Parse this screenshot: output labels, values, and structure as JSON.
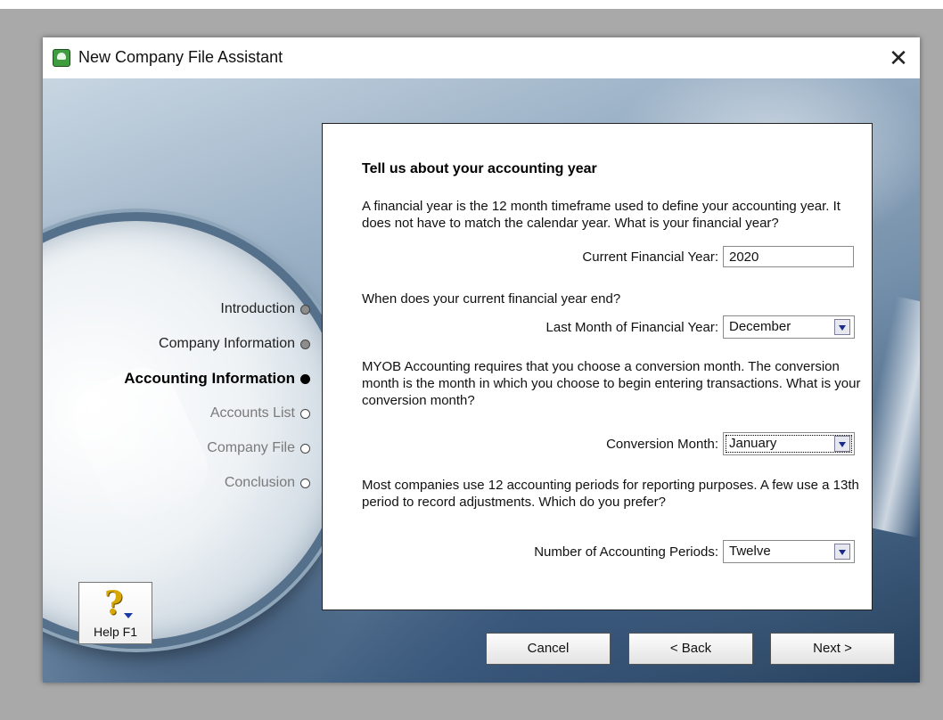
{
  "window": {
    "title": "New Company File Assistant",
    "close_symbol": "✕"
  },
  "steps": [
    {
      "label": "Introduction",
      "state": "done"
    },
    {
      "label": "Company Information",
      "state": "done"
    },
    {
      "label": "Accounting Information",
      "state": "active"
    },
    {
      "label": "Accounts List",
      "state": "pending"
    },
    {
      "label": "Company File",
      "state": "pending"
    },
    {
      "label": "Conclusion",
      "state": "pending"
    }
  ],
  "panel": {
    "heading": "Tell us about your accounting year",
    "intro": "A financial year is the 12 month timeframe used to define your accounting year.  It does not have to match the calendar year.  What is your financial year?",
    "current_year_label": "Current Financial Year:",
    "current_year_value": "2020",
    "year_end_question": "When does your current financial year end?",
    "last_month_label": "Last Month of Financial Year:",
    "last_month_value": "December",
    "conversion_intro": "MYOB Accounting requires that you choose a conversion month.  The conversion month is the month in which you choose to begin entering transactions.  What is your conversion month?",
    "conversion_label": "Conversion Month:",
    "conversion_value": "January",
    "periods_intro": "Most companies use 12 accounting periods for reporting purposes.  A few use a 13th period to record adjustments.  Which do you prefer?",
    "periods_label": "Number of Accounting Periods:",
    "periods_value": "Twelve"
  },
  "buttons": {
    "help": "Help F1",
    "cancel": "Cancel",
    "back": "< Back",
    "next": "Next >"
  }
}
